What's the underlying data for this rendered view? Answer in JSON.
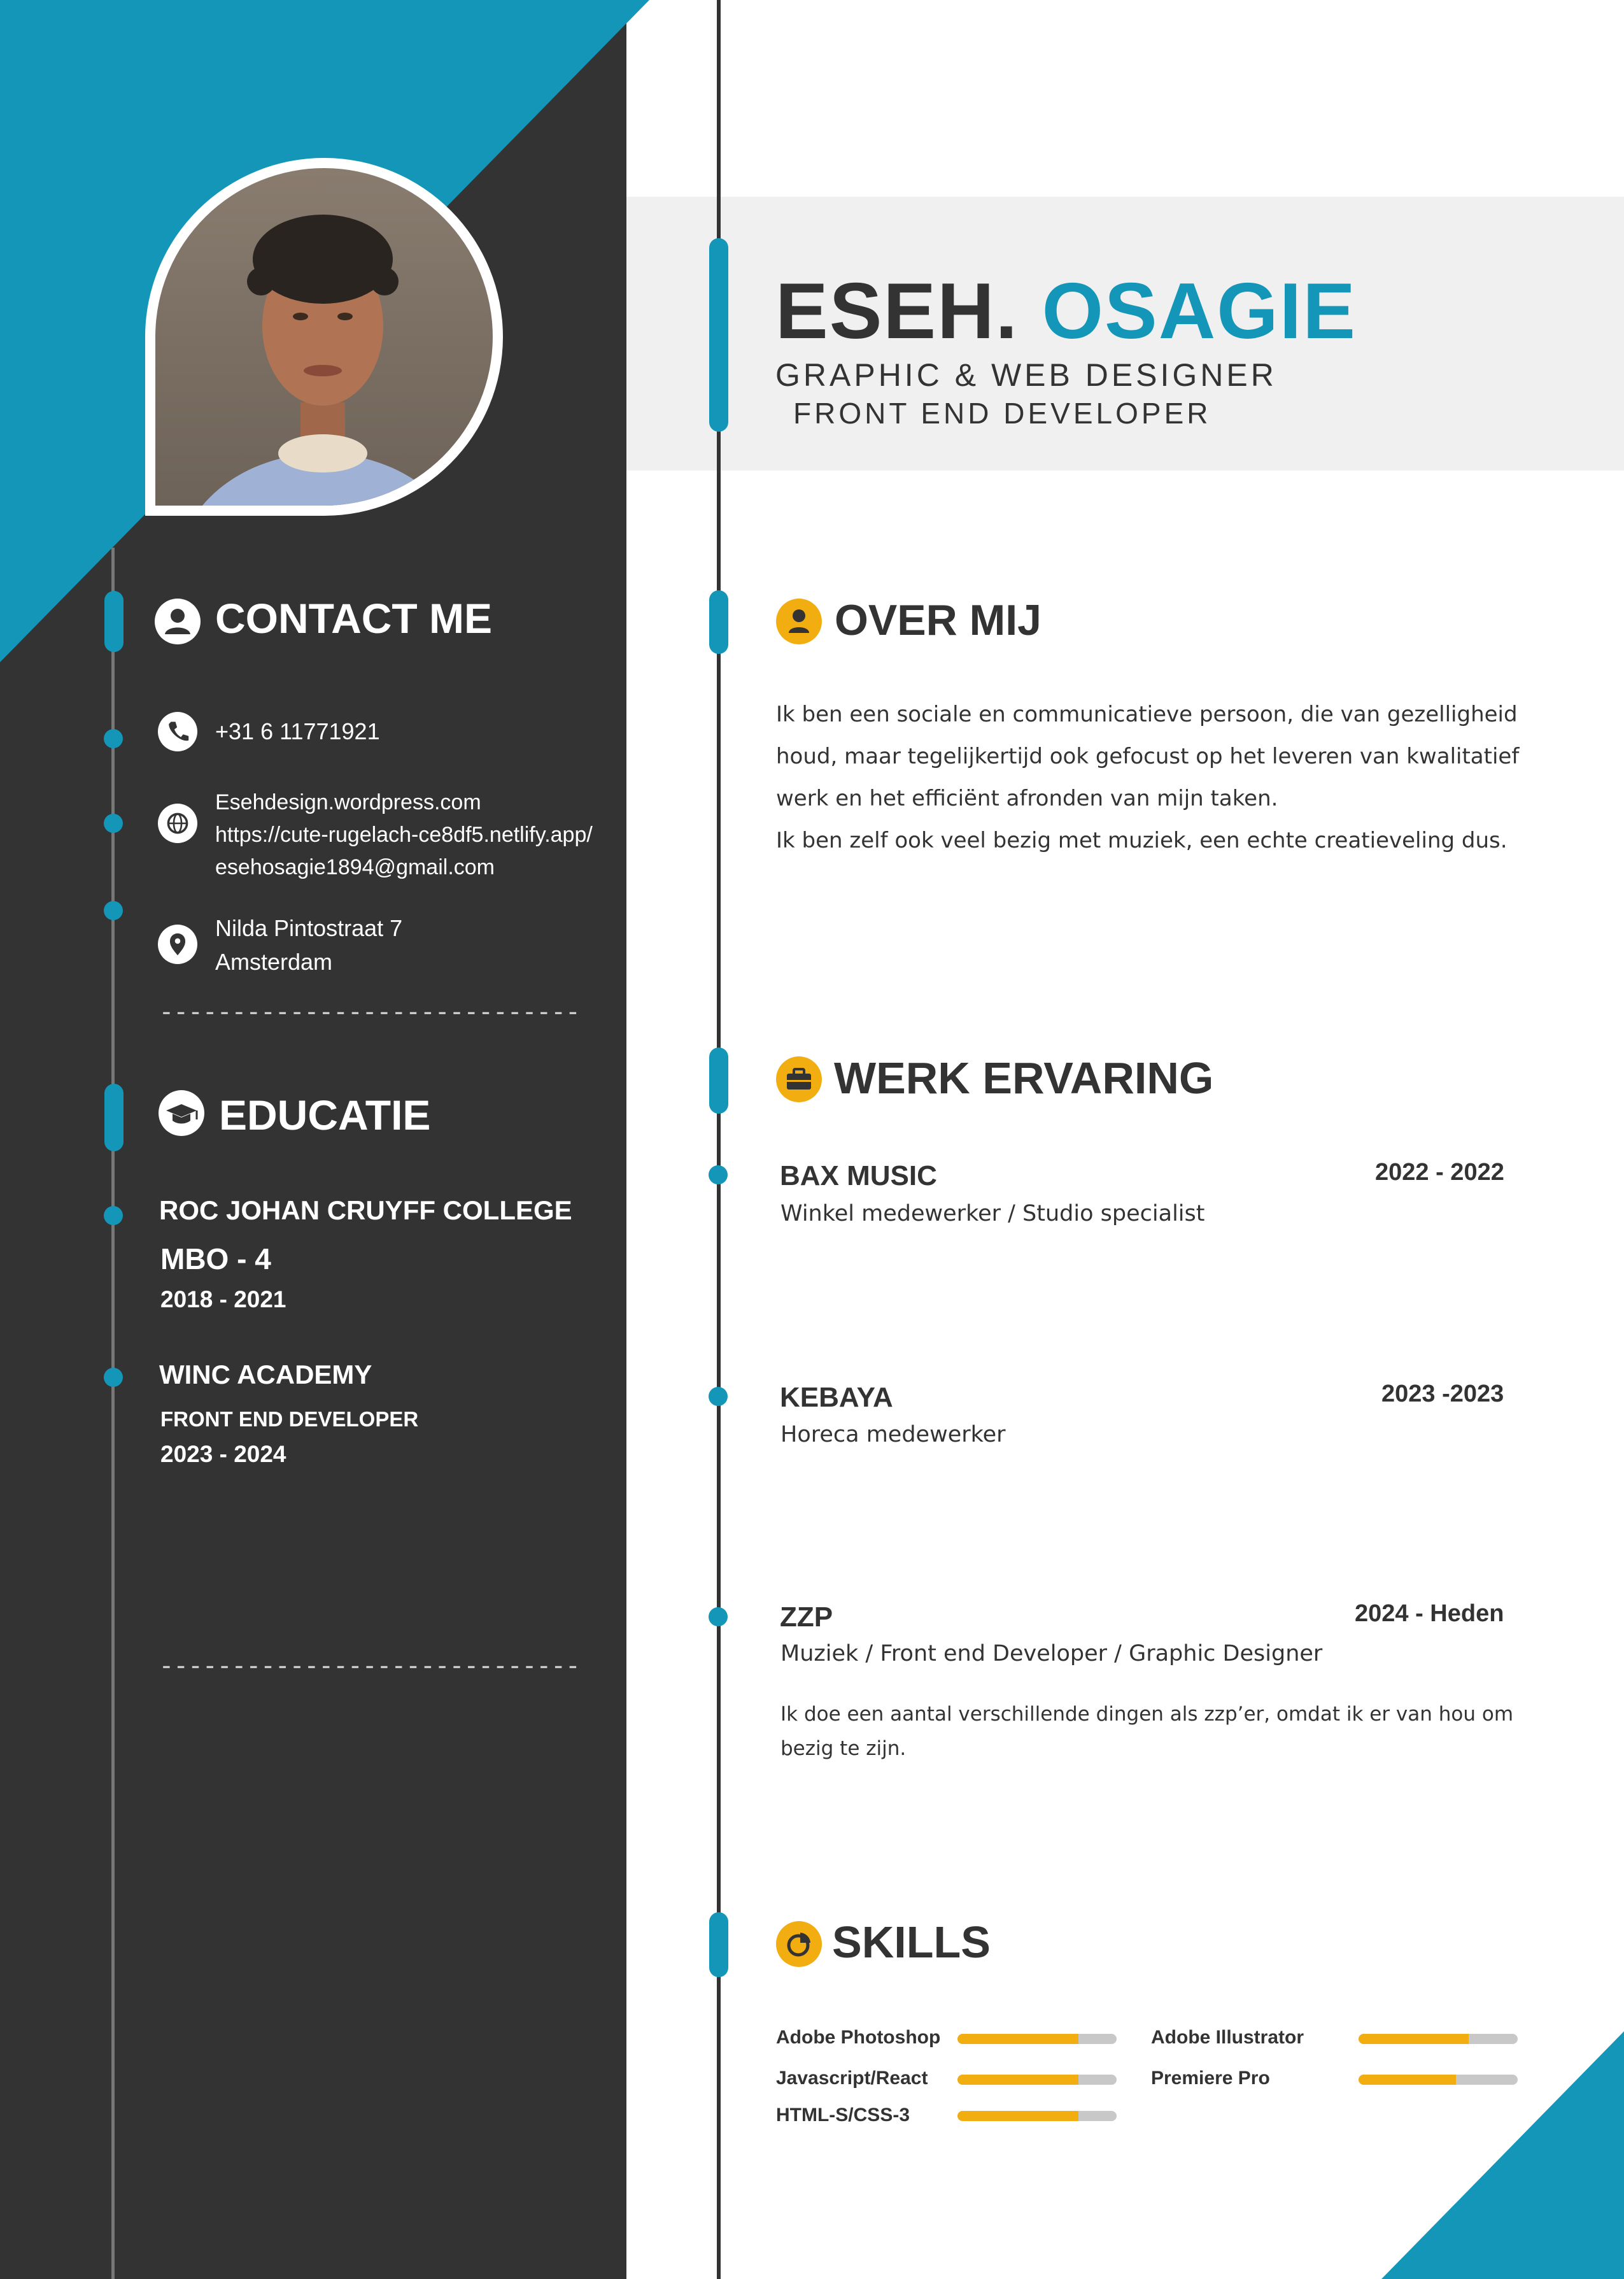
{
  "colors": {
    "accent": "#1496b9",
    "dark": "#333333",
    "yellow": "#f2ad10"
  },
  "header": {
    "first_name": "ESEH.",
    "last_name": "OSAGIE",
    "role_line1": "GRAPHIC & WEB DESIGNER",
    "role_line2": "FRONT END DEVELOPER"
  },
  "contact": {
    "title": "CONTACT ME",
    "phone": "+31 6 11771921",
    "website": "Esehdesign.wordpress.com",
    "netlify": "https://cute-rugelach-ce8df5.netlify.app/",
    "email": "esehosagie1894@gmail.com",
    "street": "Nilda Pintostraat 7",
    "city": "Amsterdam"
  },
  "education": {
    "title": "EDUCATIE",
    "items": [
      {
        "school": "ROC JOHAN CRUYFF COLLEGE",
        "level": "MBO - 4",
        "years": "2018 - 2021"
      },
      {
        "school": "WINC ACADEMY",
        "level": "FRONT END DEVELOPER",
        "years": "2023 - 2024"
      }
    ]
  },
  "dashes": "-----------------------------",
  "about": {
    "title": "OVER MIJ",
    "lines": [
      "Ik ben een sociale en communicatieve persoon, die van gezelligheid",
      "houd, maar tegelijkertijd ook gefocust op het leveren van kwalitatief",
      "werk en het efficiënt afronden van mijn taken.",
      "Ik ben zelf ook veel bezig met muziek, een echte creatieveling dus."
    ]
  },
  "work": {
    "title": "WERK ERVARING",
    "items": [
      {
        "company": "BAX MUSIC",
        "years": "2022 - 2022",
        "role": "Winkel medewerker / Studio specialist"
      },
      {
        "company": "KEBAYA",
        "years": "2023 -2023",
        "role": "Horeca medewerker"
      },
      {
        "company": "ZZP",
        "years": "2024 - Heden",
        "role": "Muziek / Front end Developer / Graphic Designer",
        "desc1": "Ik doe een aantal verschillende dingen als zzp’er, omdat ik er van hou om",
        "desc2": "bezig te zijn."
      }
    ]
  },
  "skills": {
    "title": "SKILLS",
    "items": [
      {
        "name": "Adobe Photoshop",
        "level": 0.76
      },
      {
        "name": "Adobe Illustrator",
        "level": 0.69
      },
      {
        "name": "Javascript/React",
        "level": 0.76
      },
      {
        "name": "Premiere Pro",
        "level": 0.61
      },
      {
        "name": "HTML-S/CSS-3",
        "level": 0.76
      }
    ]
  },
  "icons": [
    "user-icon",
    "phone-icon",
    "globe-icon",
    "map-pin-icon",
    "graduation-cap-icon",
    "person-icon",
    "briefcase-icon",
    "pie-chart-icon"
  ]
}
